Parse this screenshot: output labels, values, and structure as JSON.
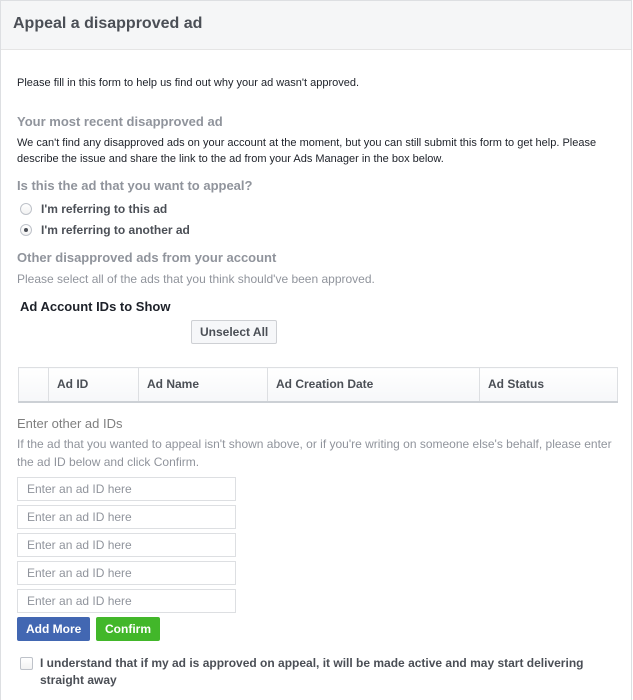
{
  "dialog": {
    "title": "Appeal a disapproved ad"
  },
  "intro": "Please fill in this form to help us find out why your ad wasn't approved.",
  "recent": {
    "title": "Your most recent disapproved ad",
    "description": "We can't find any disapproved ads on your account at the moment, but you can still submit this form to get help. Please describe the issue and share the link to the ad from your Ads Manager in the box below."
  },
  "question": {
    "title": "Is this the ad that you want to appeal?",
    "options": [
      {
        "label": "I'm referring to this ad",
        "checked": false
      },
      {
        "label": "I'm referring to another ad",
        "checked": true
      }
    ]
  },
  "other_ads": {
    "title": "Other disapproved ads from your account",
    "description": "Please select all of the ads that you think should've been approved.",
    "account_ids_title": "Ad Account IDs to Show",
    "unselect_all_label": "Unselect All",
    "table": {
      "columns": [
        "",
        "Ad ID",
        "Ad Name",
        "Ad Creation Date",
        "Ad Status"
      ],
      "rows": []
    }
  },
  "enter_ids": {
    "title": "Enter other ad IDs",
    "description": "If the ad that you wanted to appeal isn't shown above, or if you're writing on someone else's behalf, please enter the ad ID below and click Confirm.",
    "inputs": [
      {
        "value": "",
        "placeholder": "Enter an ad ID here"
      },
      {
        "value": "",
        "placeholder": "Enter an ad ID here"
      },
      {
        "value": "",
        "placeholder": "Enter an ad ID here"
      },
      {
        "value": "",
        "placeholder": "Enter an ad ID here"
      },
      {
        "value": "",
        "placeholder": "Enter an ad ID here"
      }
    ],
    "add_more_label": "Add More",
    "confirm_label": "Confirm"
  },
  "agreement": {
    "label": "I understand that if my ad is approved on appeal, it will be made active and may start delivering straight away",
    "checked": false
  },
  "colors": {
    "primary_blue": "#4267b2",
    "confirm_green": "#42b72a",
    "header_bg": "#f5f6f7",
    "muted_text": "#90949c"
  }
}
